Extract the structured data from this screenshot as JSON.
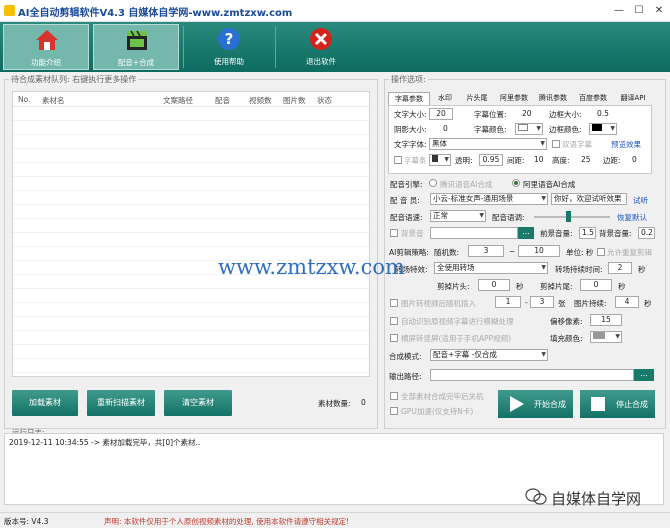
{
  "window": {
    "title": "AI全自动剪辑软件V4.3   自媒体自学网-www.zmtzxw.com",
    "min": "—",
    "max": "☐",
    "close": "✕"
  },
  "toolbar": {
    "items": [
      {
        "label": "功能介绍",
        "icon": "home-icon"
      },
      {
        "label": "配音+合成",
        "icon": "film-clapper-icon"
      },
      {
        "label": "使用帮助",
        "icon": "help-icon"
      },
      {
        "label": "退出软件",
        "icon": "exit-icon"
      }
    ]
  },
  "queue": {
    "legend": "待合成素材队列: 右键执行更多操作",
    "columns": [
      "No.",
      "素材名",
      "文案路径",
      "配音",
      "视频数",
      "图片数",
      "状态"
    ],
    "buttons": {
      "load": "加载素材",
      "rescan": "重新扫描素材",
      "clear": "清空素材"
    },
    "count_label": "素材数量:",
    "count_value": "0"
  },
  "options": {
    "legend": "操作选项:",
    "tabs": [
      "字幕参数",
      "水印",
      "片头尾",
      "阿里参数",
      "腾讯参数",
      "百度参数",
      "翻译API"
    ],
    "subtitle": {
      "font_size_label": "文字大小:",
      "font_size": "20",
      "position_label": "字幕位置:",
      "position": "20",
      "border_size_label": "边框大小:",
      "border_size": "0.5",
      "shadow_label": "阴影大小:",
      "shadow": "0",
      "color_label": "字幕颜色:",
      "border_color_label": "边框颜色:",
      "font_label": "文字字体:",
      "font": "黑体",
      "bilingual_label": "双语字幕",
      "preview_label": "预览效果",
      "bar_label": "字幕条",
      "alpha_label": "透明:",
      "alpha": "0.95",
      "spacing_label": "间距:",
      "spacing": "10",
      "height_label": "高度:",
      "height": "25",
      "margin_label": "边距:",
      "margin": "0"
    },
    "dub": {
      "engine_label": "配音引擎:",
      "engine_tencent": "腾讯语音AI合成",
      "engine_ali": "阿里语音AI合成",
      "voice_label": "配 音 员:",
      "voice": "小云-标准女声-通用场景",
      "test_text": "你好，欢迎试听效果",
      "try_label": "试听",
      "speed_label": "配音语速:",
      "speed": "正常",
      "tone_label": "配音语调:",
      "reset_label": "恢复默认",
      "bg_label": "背景音",
      "bg_btn": "...",
      "fg_vol_label": "前景音量:",
      "fg_vol": "1.5",
      "bg_vol_label": "背景音量:",
      "bg_vol": "0.2"
    },
    "edit": {
      "strategy_label": "AI剪辑策略:",
      "random_label": "随机数:",
      "random_min": "3",
      "random_max": "10",
      "unit_label": "单位: 秒",
      "reuse_label": "允许重复剪辑",
      "transition_label": "转场特效:",
      "transition": "全使用转场",
      "transition_dur_label": "转场持续时间:",
      "transition_dur": "2",
      "sec": "秒",
      "cut_head_label": "剪掉片头:",
      "cut_head": "0",
      "cut_tail_label": "剪掉片尾:",
      "cut_tail": "0",
      "img_insert_label": "图片转视频后随机插入",
      "img_min": "1",
      "img_max": "3",
      "zhang": "张",
      "img_dur_label": "图片持续:",
      "img_dur": "4",
      "blur_label": "自动识别原视频字幕进行模糊处理",
      "offset_label": "偏移像素:",
      "offset": "15",
      "landscape_label": "横屏转竖屏(适用于手机APP视频)",
      "fill_label": "填充颜色:",
      "mode_label": "合成模式:",
      "mode": "配音+字幕 -仅合成",
      "output_label": "输出路径:",
      "output_btn": "...",
      "shutdown_label": "全部素材合成完毕后关机",
      "gpu_label": "GPU加速(仅支持N卡)",
      "start_label": "开始合成",
      "stop_label": "停止合成"
    }
  },
  "log": {
    "legend": "运行日志:",
    "text": "2019-12-11 10:34:55 -> 素材加载完毕，共[0]个素材.."
  },
  "status": {
    "version": "版本号: V4.3",
    "notice": "声明: 本软件仅用于个人原创视频素材的处理, 使用本软件请遵守相关规定!"
  },
  "watermark": {
    "url": "www.zmtzxw.com",
    "brand": "自媒体自学网"
  },
  "colors": {
    "teal": "#137266",
    "link": "#1b53c7"
  }
}
